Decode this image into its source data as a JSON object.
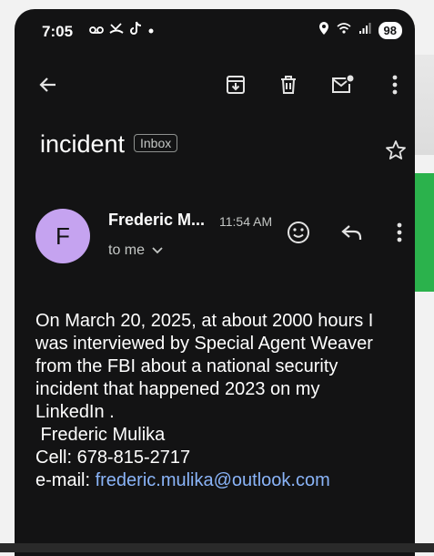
{
  "status_bar": {
    "time": "7:05",
    "battery": "98",
    "left_icons": [
      "voicemail-icon",
      "missed-call-icon",
      "tiktok-icon",
      "dot-icon"
    ],
    "right_icons": [
      "location-icon",
      "wifi-icon",
      "signal-icon"
    ]
  },
  "toolbar": {
    "actions": [
      "back-icon",
      "archive-icon",
      "delete-icon",
      "mark-unread-icon",
      "more-icon"
    ]
  },
  "email": {
    "subject": "incident",
    "label": "Inbox",
    "sender_initial": "F",
    "sender_name": "Frederic M...",
    "time": "11:54 AM",
    "recipient": "to me",
    "body_lines": [
      "On March 20, 2025, at about 2000 hours I",
      "was interviewed by Special Agent Weaver",
      "from the FBI about a national security",
      "incident that happened 2023 on my",
      "LinkedIn ."
    ],
    "signature_name": " Frederic Mulika",
    "signature_cell": "Cell: 678-815-2717",
    "email_label": "e-mail: ",
    "email_address": "frederic.mulika@outlook.com"
  },
  "colors": {
    "background": "#131314",
    "avatar": "#c5a3f0",
    "link": "#8ab4f8"
  }
}
